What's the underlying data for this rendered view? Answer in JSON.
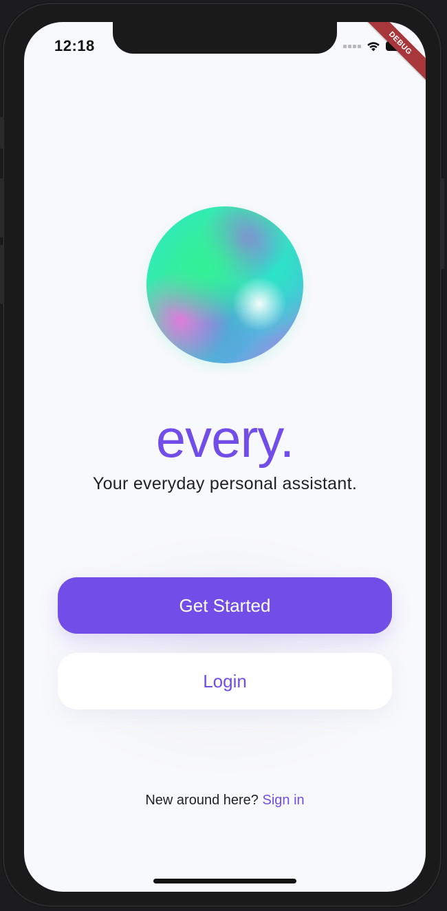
{
  "status_bar": {
    "time": "12:18",
    "icons": [
      "cellular-signal-icon",
      "wifi-icon",
      "battery-icon"
    ]
  },
  "debug_banner": "DEBUG",
  "brand": {
    "name": "every.",
    "tagline": "Your everyday personal assistant."
  },
  "actions": {
    "primary_label": "Get Started",
    "secondary_label": "Login"
  },
  "footer": {
    "prompt": "New around here?",
    "link_label": "Sign in"
  },
  "colors": {
    "accent": "#724de8",
    "background": "#f8f9fc",
    "text": "#222222",
    "debug_banner": "#a8373b"
  }
}
